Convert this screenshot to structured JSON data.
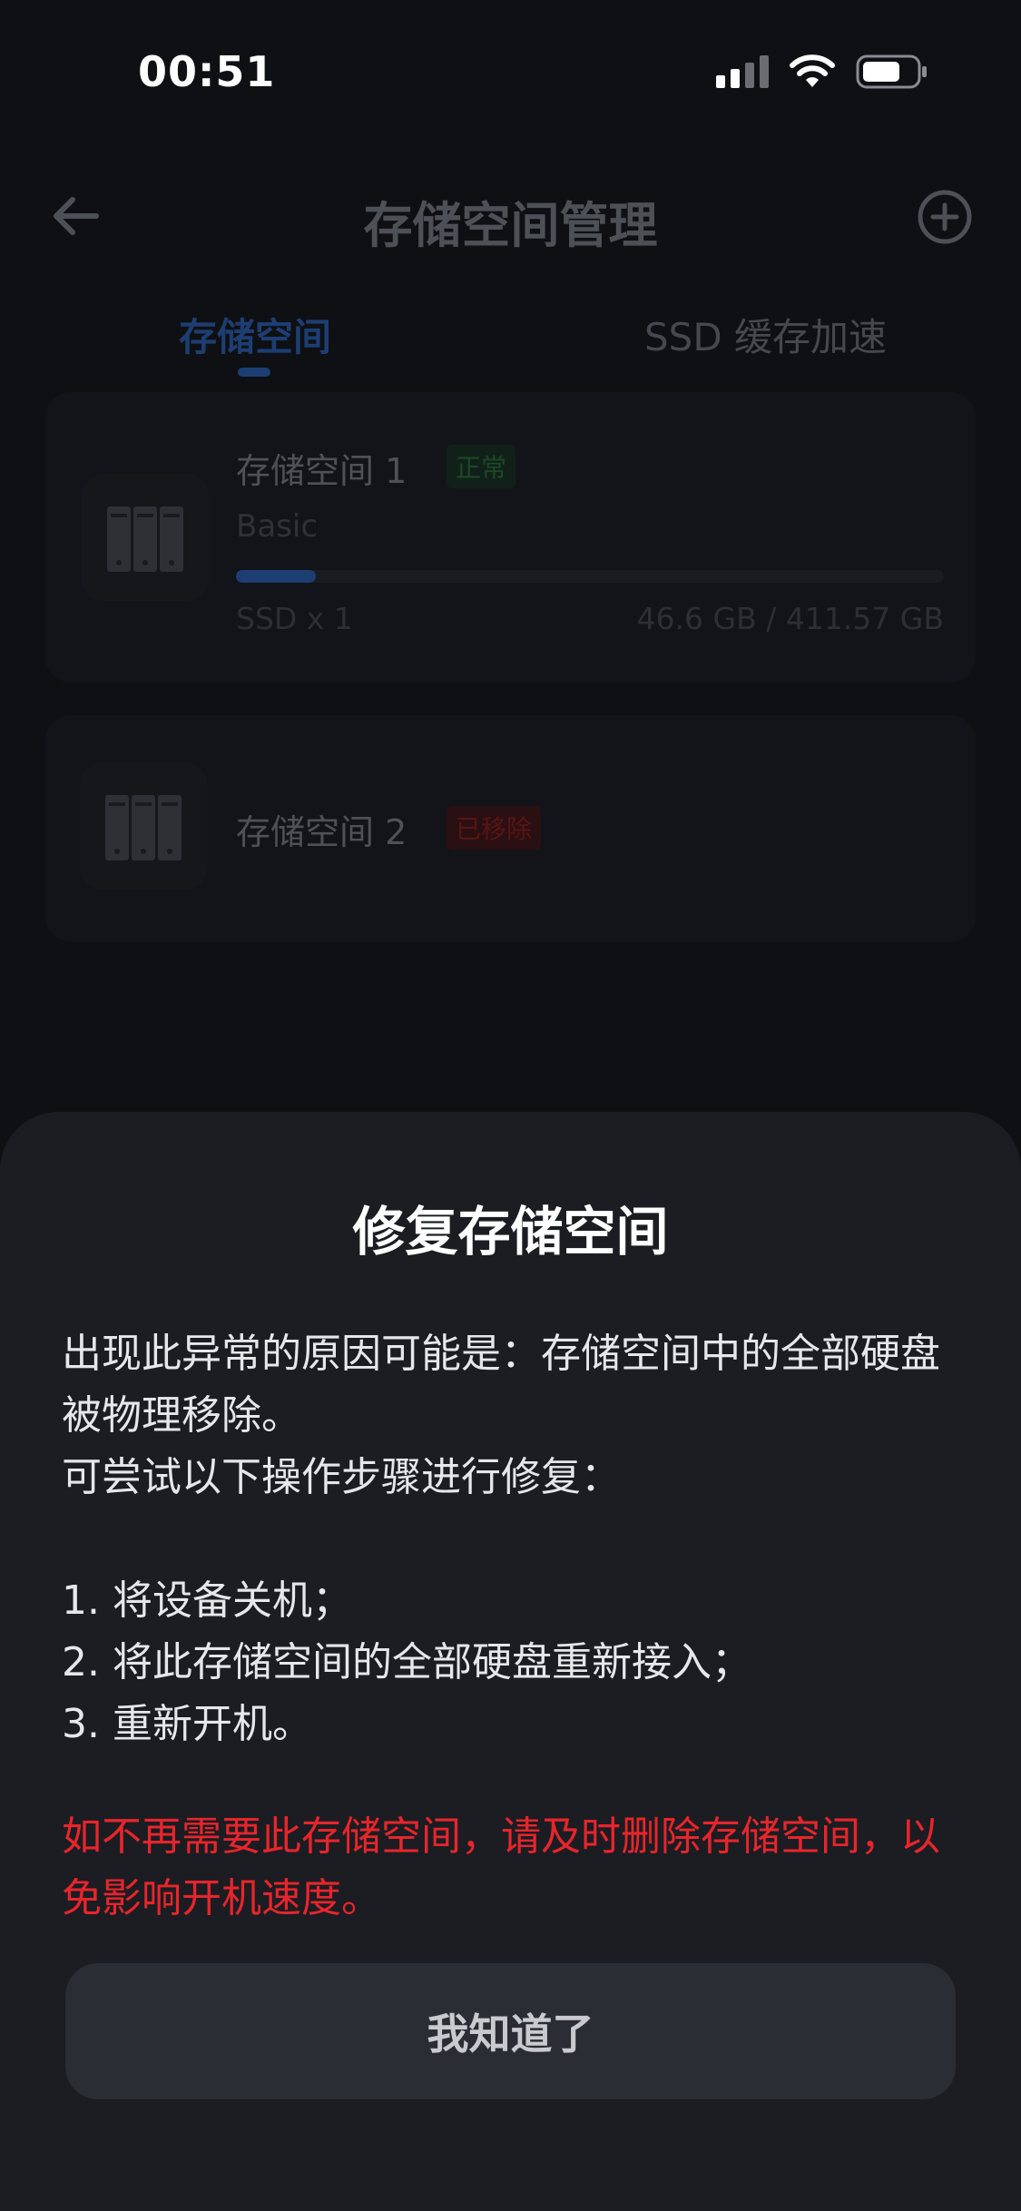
{
  "status_bar": {
    "time": "00:51"
  },
  "nav": {
    "title": "存储空间管理",
    "back_icon": "arrow-left-icon",
    "add_icon": "plus-circle-icon"
  },
  "tabs": [
    {
      "label": "存储空间",
      "active": true
    },
    {
      "label": "SSD 缓存加速",
      "active": false
    }
  ],
  "storage_pools": [
    {
      "name": "存储空间 1",
      "status": "正常",
      "type": "Basic",
      "usage_fraction": 0.113,
      "disks": "SSD x 1",
      "capacity": "46.6 GB / 411.57 GB"
    },
    {
      "name": "存储空间 2",
      "status": "已移除"
    }
  ],
  "sheet": {
    "title": "修复存储空间",
    "body_lines": [
      "出现此异常的原因可能是：存储空间中的全部硬盘被物理移除。",
      "可尝试以下操作步骤进行修复："
    ],
    "steps": [
      "1. 将设备关机；",
      "2. 将此存储空间的全部硬盘重新接入；",
      "3. 重新开机。"
    ],
    "warning": "如不再需要此存储空间，请及时删除存储空间，以免影响开机速度。",
    "confirm_label": "我知道了"
  },
  "colors": {
    "accent": "#1d3e73",
    "warning": "#e8252c",
    "sheet_bg": "#1b1d22",
    "ok_badge": "#1c4a25",
    "removed_badge": "#5a1414"
  }
}
